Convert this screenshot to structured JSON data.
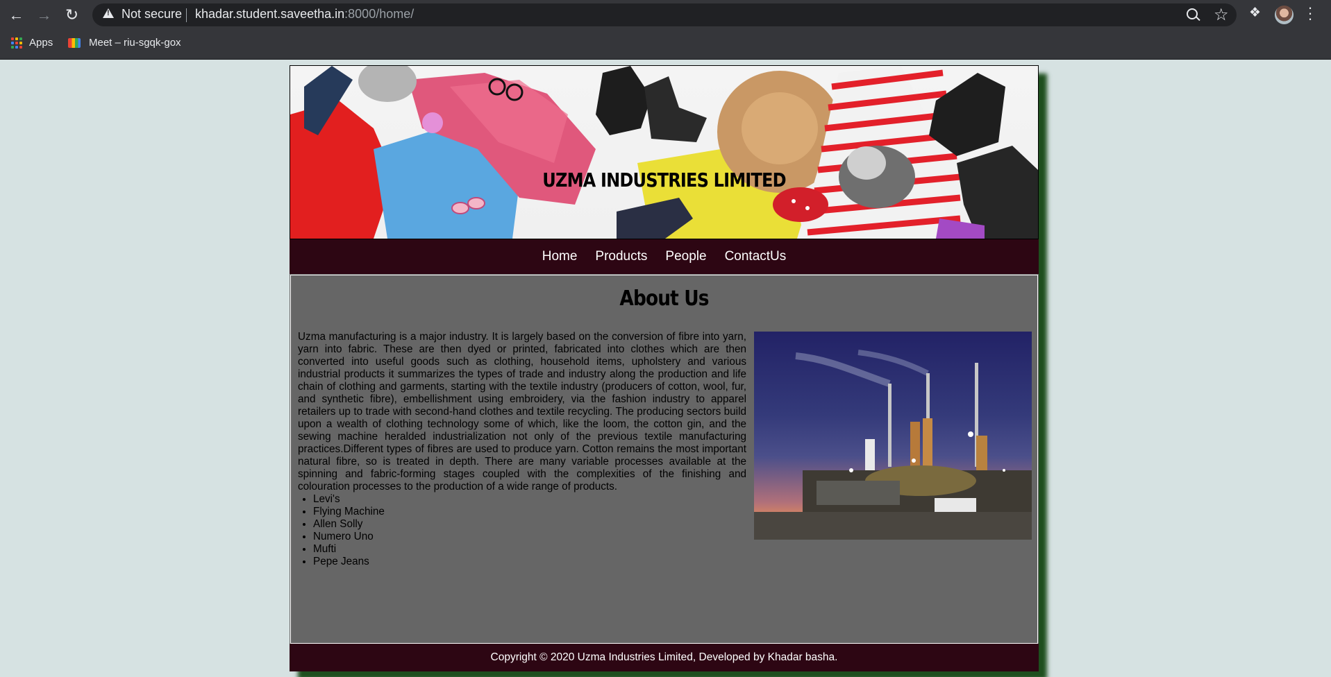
{
  "browser": {
    "security_label": "Not secure",
    "url_host": "khadar.student.saveetha.in",
    "url_path": ":8000/home/",
    "bookmarks": [
      {
        "label": "Apps",
        "icon": "apps-grid-icon"
      },
      {
        "label": "Meet – riu-sgqk-gox",
        "icon": "google-meet-icon"
      }
    ]
  },
  "site": {
    "banner_title": "UZMA INDUSTRIES LIMITED",
    "nav": [
      "Home",
      "Products",
      "People",
      "ContactUs"
    ],
    "heading": "About Us",
    "about_text": "Uzma manufacturing is a major industry. It is largely based on the conversion of fibre into yarn, yarn into fabric. These are then dyed or printed, fabricated into clothes which are then converted into useful goods such as clothing, household items, upholstery and various industrial products it summarizes the types of trade and industry along the production and life chain of clothing and garments, starting with the textile industry (producers of cotton, wool, fur, and synthetic fibre), embellishment using embroidery, via the fashion industry to apparel retailers up to trade with second-hand clothes and textile recycling. The producing sectors build upon a wealth of clothing technology some of which, like the loom, the cotton gin, and the sewing machine heralded industrialization not only of the previous textile manufacturing practices.Different types of fibres are used to produce yarn. Cotton remains the most important natural fibre, so is treated in depth. There are many variable processes available at the spinning and fabric-forming stages coupled with the complexities of the finishing and colouration processes to the production of a wide range of products.",
    "brands": [
      "Levi's",
      "Flying Machine",
      "Allen Solly",
      "Numero Uno",
      "Mufti",
      "Pepe Jeans"
    ],
    "footer": "Copyright © 2020 Uzma Industries Limited, Developed by Khadar basha."
  },
  "colors": {
    "page_bg": "#d6e2e2",
    "nav_bg": "#2d0613",
    "content_bg": "#666666",
    "shadow": "#1e4f1e"
  }
}
